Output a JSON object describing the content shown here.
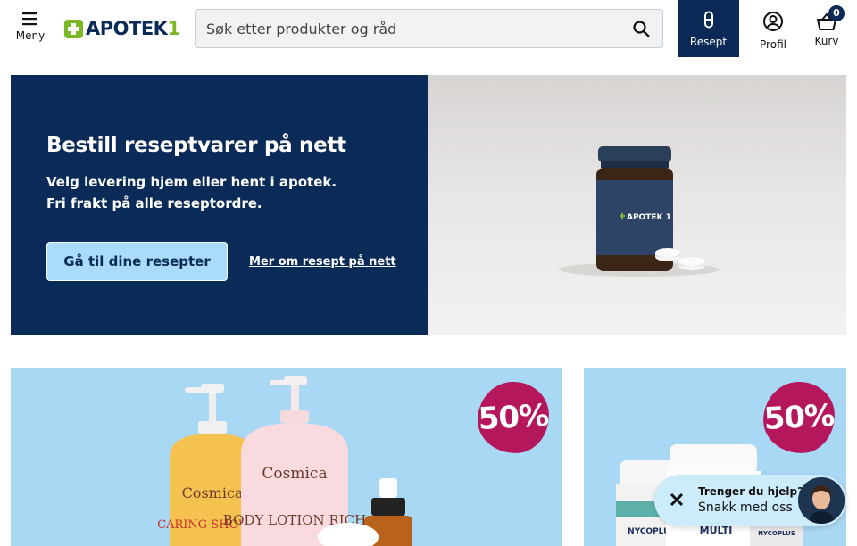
{
  "header": {
    "menu_label": "Meny",
    "logo_text": "APOTEK",
    "logo_number": "1",
    "search_placeholder": "Søk etter produkter og råd",
    "resept_label": "Resept",
    "profil_label": "Profil",
    "kurv_label": "Kurv",
    "cart_count": "0"
  },
  "hero": {
    "title": "Bestill reseptvarer på nett",
    "subtitle_line1": "Velg levering hjem eller hent i apotek.",
    "subtitle_line2": "Fri frakt på alle reseptordre.",
    "button_label": "Gå til dine resepter",
    "link_label": "Mer om resept på nett",
    "jar_label": "APOTEK 1"
  },
  "promos": [
    {
      "discount": "50%",
      "products": [
        "Cosmica",
        "CARING SHOWER",
        "Cosmica",
        "BODY LOTION RICH"
      ]
    },
    {
      "discount": "50%",
      "products": [
        "NYCOPLUS",
        "MULTI",
        "NYCOPLUS"
      ]
    }
  ],
  "chat": {
    "title": "Trenger du hjelp?",
    "subtitle": "Snakk med oss"
  },
  "colors": {
    "navy": "#0a2a57",
    "brand_green": "#7ab826",
    "light_blue": "#a9dcfa",
    "promo_bg": "#a9d8f5",
    "discount_badge": "#b5175c"
  }
}
